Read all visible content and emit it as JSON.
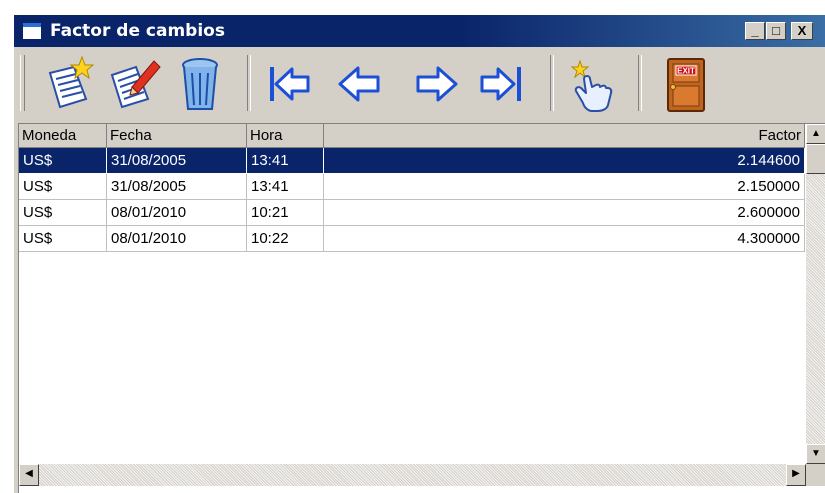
{
  "window": {
    "title": "Factor de cambios",
    "controls": {
      "minimize": "_",
      "maximize": "□",
      "close": "X"
    }
  },
  "toolbar": {
    "buttons": [
      {
        "name": "new-record-button",
        "icon": "new-document-star-icon"
      },
      {
        "name": "edit-record-button",
        "icon": "edit-document-pencil-icon"
      },
      {
        "name": "delete-record-button",
        "icon": "trash-can-icon"
      },
      {
        "name": "first-record-button",
        "icon": "arrow-first-icon"
      },
      {
        "name": "previous-record-button",
        "icon": "arrow-left-icon"
      },
      {
        "name": "next-record-button",
        "icon": "arrow-right-icon"
      },
      {
        "name": "last-record-button",
        "icon": "arrow-last-icon"
      },
      {
        "name": "select-button",
        "icon": "hand-pointer-icon"
      },
      {
        "name": "exit-button",
        "icon": "exit-door-icon",
        "label": "EXIT"
      }
    ]
  },
  "grid": {
    "columns": [
      "Moneda",
      "Fecha",
      "Hora",
      "Factor"
    ],
    "rows": [
      {
        "moneda": "US$",
        "fecha": "31/08/2005",
        "hora": "13:41",
        "factor": "2.144600",
        "selected": true
      },
      {
        "moneda": "US$",
        "fecha": "31/08/2005",
        "hora": "13:41",
        "factor": "2.150000",
        "selected": false
      },
      {
        "moneda": "US$",
        "fecha": "08/01/2010",
        "hora": "10:21",
        "factor": "2.600000",
        "selected": false
      },
      {
        "moneda": "US$",
        "fecha": "08/01/2010",
        "hora": "10:22",
        "factor": "4.300000",
        "selected": false
      }
    ]
  },
  "colors": {
    "titlebar": "#0a246a",
    "selection": "#0a246a",
    "face": "#d4d0c8",
    "exit_door": "#c0651e",
    "exit_sign": "#d01010",
    "arrow_fill": "#ffffff",
    "arrow_stroke": "#1c4fd8"
  }
}
